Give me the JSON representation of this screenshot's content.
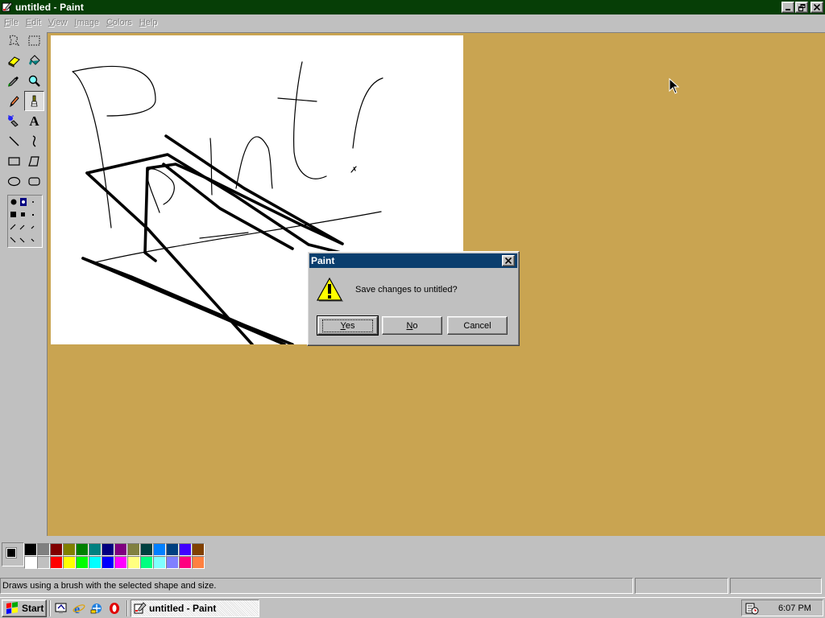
{
  "window": {
    "title": "untitled - Paint",
    "controls": [
      "minimize",
      "restore",
      "close"
    ]
  },
  "menu": [
    "File",
    "Edit",
    "View",
    "Image",
    "Colors",
    "Help"
  ],
  "toolbox": {
    "tools": [
      {
        "name": "free-form-select-icon"
      },
      {
        "name": "select-icon"
      },
      {
        "name": "eraser-icon"
      },
      {
        "name": "fill-with-color-icon"
      },
      {
        "name": "pick-color-icon"
      },
      {
        "name": "magnifier-icon"
      },
      {
        "name": "pencil-icon"
      },
      {
        "name": "brush-icon",
        "active": true
      },
      {
        "name": "airbrush-icon"
      },
      {
        "name": "text-icon",
        "glyph": "A"
      },
      {
        "name": "line-icon"
      },
      {
        "name": "curve-icon"
      },
      {
        "name": "rectangle-icon"
      },
      {
        "name": "polygon-icon"
      },
      {
        "name": "ellipse-icon"
      },
      {
        "name": "rounded-rectangle-icon"
      }
    ]
  },
  "palette": {
    "foreground": "#000000",
    "background": "#ffffff",
    "row1": [
      "#000000",
      "#808080",
      "#800000",
      "#808000",
      "#008000",
      "#008080",
      "#000080",
      "#800080",
      "#808040",
      "#004040",
      "#0080ff",
      "#004080",
      "#4000ff",
      "#804000"
    ],
    "row2": [
      "#ffffff",
      "#c0c0c0",
      "#ff0000",
      "#ffff00",
      "#00ff00",
      "#00ffff",
      "#0000ff",
      "#ff00ff",
      "#ffff80",
      "#00ff80",
      "#80ffff",
      "#8080ff",
      "#ff0080",
      "#ff8040"
    ]
  },
  "status": {
    "message": "Draws using a brush with the selected shape and size."
  },
  "taskbar": {
    "start_label": "Start",
    "task_label": "untitled - Paint",
    "clock": "6:07 PM"
  },
  "dialog": {
    "title": "Paint",
    "message": "Save changes to untitled?",
    "yes_accel": "Y",
    "yes_rest": "es",
    "no_accel": "N",
    "no_rest": "o",
    "cancel_label": "Cancel",
    "icon": "warning-icon"
  }
}
